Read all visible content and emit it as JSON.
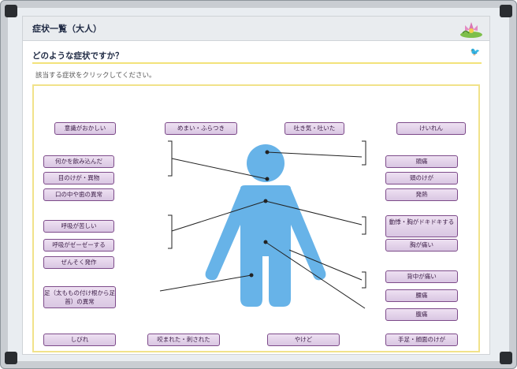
{
  "header": {
    "title": "症状一覧（大人）",
    "icon": "flower-icon"
  },
  "prompt": {
    "question": "どのような症状ですか？",
    "instruction": "該当する症状をクリックしてください。"
  },
  "top_row": [
    "意識がおかしい",
    "めまい・ふらつき",
    "吐き気・吐いた",
    "けいれん"
  ],
  "left_group1": [
    "何かを飲み込んだ",
    "目のけが・異物",
    "口の中や歯の異常"
  ],
  "left_group2": [
    "呼吸が苦しい",
    "呼吸がゼーゼーする",
    "ぜんそく発作"
  ],
  "left_single": "足（太ももの付け根から足首）の異常",
  "right_group1": [
    "頭痛",
    "頭のけが",
    "発熱"
  ],
  "right_group2": [
    "動悸・胸がドキドキする",
    "胸が痛い"
  ],
  "right_group3": [
    "背中が痛い",
    "腰痛",
    "腹痛"
  ],
  "bottom_row": [
    "しびれ",
    "咬まれた・刺された",
    "やけど",
    "手足・顔面のけが"
  ],
  "colors": {
    "body": "#67b3e8",
    "button_border": "#7d4b8a",
    "button_fill": "#e4d3eb",
    "accent_line": "#f1e28a"
  }
}
